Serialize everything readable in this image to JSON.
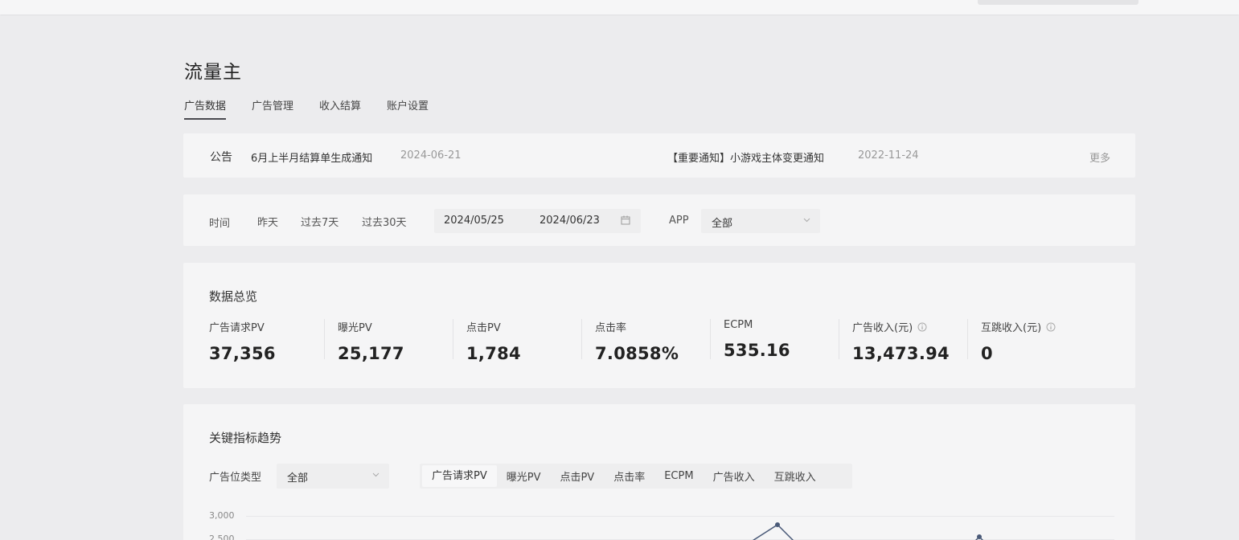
{
  "page_title": "流量主",
  "tabs": [
    {
      "label": "广告数据",
      "active": true
    },
    {
      "label": "广告管理",
      "active": false
    },
    {
      "label": "收入结算",
      "active": false
    },
    {
      "label": "账户设置",
      "active": false
    }
  ],
  "notice": {
    "label": "公告",
    "items": [
      {
        "title": "6月上半月结算单生成通知",
        "date": "2024-06-21"
      },
      {
        "title": "【重要通知】小游戏主体变更通知",
        "date": "2022-11-24"
      }
    ],
    "more": "更多"
  },
  "filter": {
    "time_label": "时间",
    "quick_ranges": [
      "昨天",
      "过去7天",
      "过去30天"
    ],
    "start_date": "2024/05/25",
    "end_date": "2024/06/23",
    "app_label": "APP",
    "app_value": "全部"
  },
  "overview": {
    "title": "数据总览",
    "metrics": [
      {
        "label": "广告请求PV",
        "value": "37,356",
        "info": false
      },
      {
        "label": "曝光PV",
        "value": "25,177",
        "info": false
      },
      {
        "label": "点击PV",
        "value": "1,784",
        "info": false
      },
      {
        "label": "点击率",
        "value": "7.0858%",
        "info": false
      },
      {
        "label": "ECPM",
        "value": "535.16",
        "info": false
      },
      {
        "label": "广告收入(元)",
        "value": "13,473.94",
        "info": true
      },
      {
        "label": "互跳收入(元)",
        "value": "0",
        "info": true
      }
    ]
  },
  "trend": {
    "title": "关键指标趋势",
    "type_label": "广告位类型",
    "type_value": "全部",
    "metric_tabs": [
      "广告请求PV",
      "曝光PV",
      "点击PV",
      "点击率",
      "ECPM",
      "广告收入",
      "互跳收入"
    ],
    "active_metric": "广告请求PV",
    "y_ticks": [
      "3,000",
      "2,500"
    ]
  },
  "icons": {
    "calendar": "calendar-icon",
    "dropdown": "chevron-down-icon",
    "info": "info-icon"
  },
  "colors": {
    "line": "#4a5a78",
    "background": "#ececee",
    "card": "#f5f5f6"
  }
}
